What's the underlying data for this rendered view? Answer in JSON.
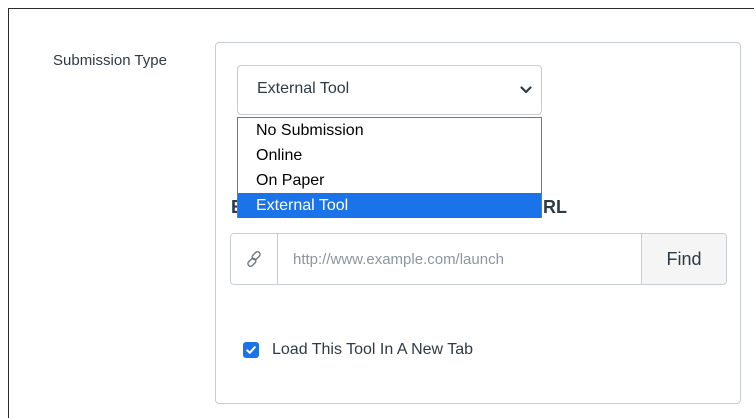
{
  "submission": {
    "label": "Submission Type",
    "selected_value": "External Tool",
    "options": [
      "No Submission",
      "Online",
      "On Paper",
      "External Tool"
    ]
  },
  "external_tool": {
    "url_label_left": "E",
    "url_label_right": "RL",
    "url_placeholder": "http://www.example.com/launch",
    "find_label": "Find",
    "new_tab_label": "Load This Tool In A New Tab",
    "new_tab_checked": true
  },
  "icons": {
    "url_addon": "link-icon",
    "select_arrow": "chevron-down-icon",
    "checkbox": "check-icon"
  },
  "colors": {
    "accent": "#1a73e8",
    "text": "#2d3b45",
    "border": "#c7cdd1"
  }
}
